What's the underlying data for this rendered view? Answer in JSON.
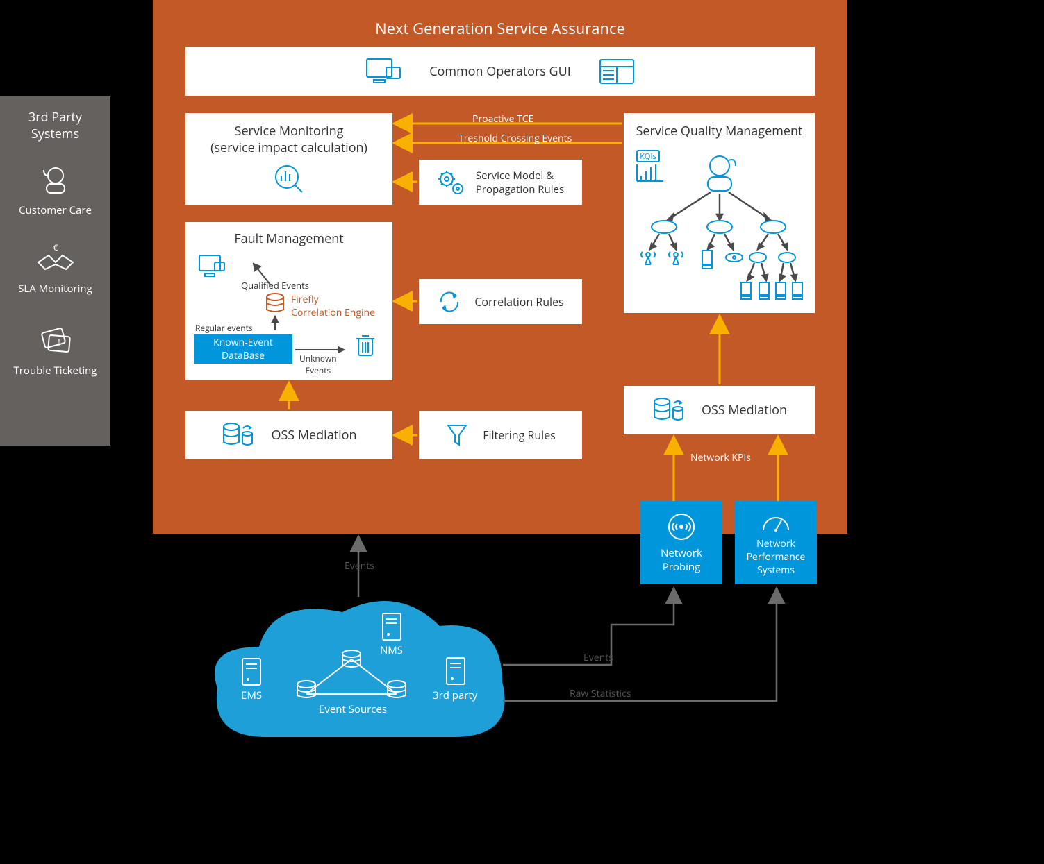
{
  "main": {
    "title": "Next Generation Service Assurance",
    "gui_box": "Common Operators GUI",
    "service_monitoring": {
      "line1": "Service Monitoring",
      "line2": "(service impact calculation)"
    },
    "sqm": "Service Quality Management",
    "kqis_badge": "KQIs",
    "service_model": {
      "line1": "Service Model &",
      "line2": "Propagation Rules"
    },
    "fault_mgmt": {
      "title": "Fault Management",
      "qualified_events": "Qualified Events",
      "firefly_l1": "Firefly",
      "firefly_l2": "Correlation Engine",
      "regular_events": "Regular events",
      "known_event_l1": "Known-Event",
      "known_event_l2": "DataBase",
      "unknown_l1": "Unknown",
      "unknown_l2": "Events"
    },
    "correlation_rules": "Correlation Rules",
    "oss_mediation_left": "OSS Mediation",
    "oss_mediation_right": "OSS Mediation",
    "filtering_rules": "Filtering Rules",
    "arrows": {
      "proactive_tce": "Proactive TCE",
      "threshold_crossing": "Treshold Crossing Events",
      "network_kpis": "Network KPIs",
      "events_left": "Events",
      "events_right": "Events",
      "raw_stats": "Raw Statistics"
    }
  },
  "sidebar": {
    "title_l1": "3rd Party",
    "title_l2": "Systems",
    "items": [
      {
        "label": "Customer Care"
      },
      {
        "label": "SLA Monitoring"
      },
      {
        "label": "Trouble Ticketing"
      }
    ]
  },
  "bottom": {
    "network_probing": {
      "l1": "Network",
      "l2": "Probing"
    },
    "network_perf": {
      "l1": "Network",
      "l2": "Performance",
      "l3": "Systems"
    },
    "cloud": {
      "ems": "EMS",
      "nms": "NMS",
      "third_party": "3rd party",
      "event_sources": "Event Sources"
    }
  }
}
